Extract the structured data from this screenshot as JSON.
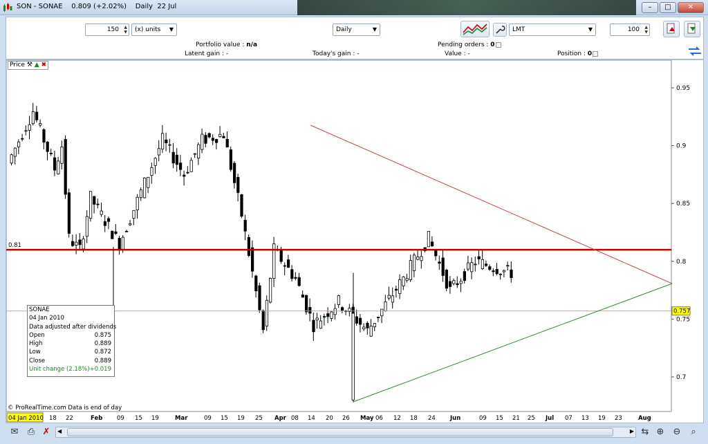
{
  "window": {
    "title": "SON - SONAE    0.809 (+2.02%)    Daily  22 Jul",
    "minimize": "–",
    "restore": "□",
    "close": "✕"
  },
  "toolbar": {
    "units_value": "150",
    "units_type": "(x) units",
    "period": "Daily",
    "order_type": "LMT",
    "order_qty": "100",
    "portfolio_label": "Portfolio value :",
    "portfolio_value": "n/a",
    "pending_label": "Pending orders :",
    "pending_value": "0",
    "latent_label": "Latent gain :",
    "latent_value": "-",
    "today_label": "Today's gain :",
    "today_value": "-",
    "value_label": "Value :",
    "value_value": "-",
    "position_label": "Position :",
    "position_value": "0"
  },
  "chart_panel": {
    "price_label": "Price",
    "y_ticks": [
      "0.95",
      "0.9",
      "0.85",
      "0.8",
      "0.75",
      "0.7"
    ],
    "level_label": "0.81",
    "last_price": "0.757",
    "x_labels": [
      "04 Jan 2010",
      "18",
      "22",
      "Feb",
      "09",
      "15",
      "19",
      "Mar",
      "09",
      "15",
      "19",
      "25",
      "Apr",
      "08",
      "14",
      "20",
      "26",
      "May",
      "06",
      "12",
      "18",
      "24",
      "Jun",
      "09",
      "15",
      "21",
      "25",
      "Jul",
      "07",
      "13",
      "19",
      "23",
      "Aug"
    ],
    "credit": "© ProRealTime.com  Data is end of day"
  },
  "infobox": {
    "name": "SONAE",
    "date": "04 Jan 2010",
    "note": "Data adjusted after dividends",
    "rows": [
      {
        "label": "Open",
        "value": "0.875"
      },
      {
        "label": "High",
        "value": "0.889"
      },
      {
        "label": "Low",
        "value": "0.872"
      },
      {
        "label": "Close",
        "value": "0.889"
      }
    ],
    "change_label": "Unit change (2.18%)",
    "change_value": "+0.019"
  },
  "colors": {
    "resistance": "#c00000",
    "upper_trend": "#c24a4a",
    "lower_trend": "#2e8b2e",
    "last_price_bg": "#ffff00",
    "change_text": "#1a8a1a"
  }
}
